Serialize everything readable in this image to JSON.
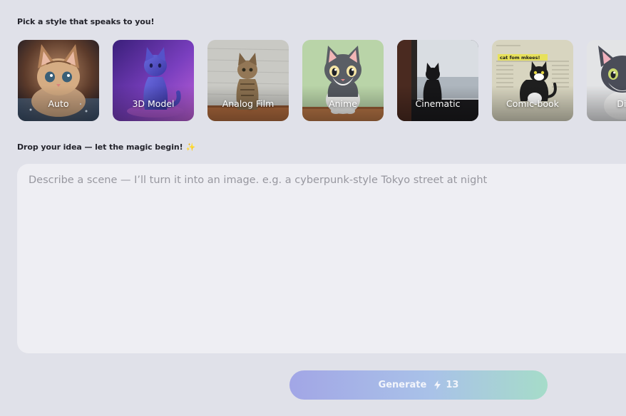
{
  "style_picker": {
    "heading": "Pick a style that speaks to you!",
    "styles": [
      {
        "label": "Auto",
        "thumb": "fluffy-kitten-photo"
      },
      {
        "label": "3D Model",
        "thumb": "purple-3d-cat"
      },
      {
        "label": "Analog Film",
        "thumb": "film-photo-tabby-cat"
      },
      {
        "label": "Anime",
        "thumb": "anime-cat-illustration"
      },
      {
        "label": "Cinematic",
        "thumb": "cat-silhouette-window"
      },
      {
        "label": "Comic-book",
        "thumb": "comic-cat-newspaper"
      },
      {
        "label": "Digit",
        "thumb": "digital-art-cat"
      }
    ]
  },
  "comic_caption": "cat fom mkees!",
  "prompt": {
    "heading": "Drop your idea — let the magic begin!",
    "heading_emoji": "✨",
    "placeholder": "Describe a scene — I’ll turn it into an image. e.g. a cyberpunk-style Tokyo street at night",
    "value": ""
  },
  "generate": {
    "label": "Generate",
    "credits": "13",
    "icon": "lightning-bolt-icon"
  },
  "colors": {
    "page_bg": "#e0e1e9",
    "input_bg": "#eeeef3",
    "button_gradient_start": "#a2a6e6",
    "button_gradient_end": "#a6dcc9"
  }
}
